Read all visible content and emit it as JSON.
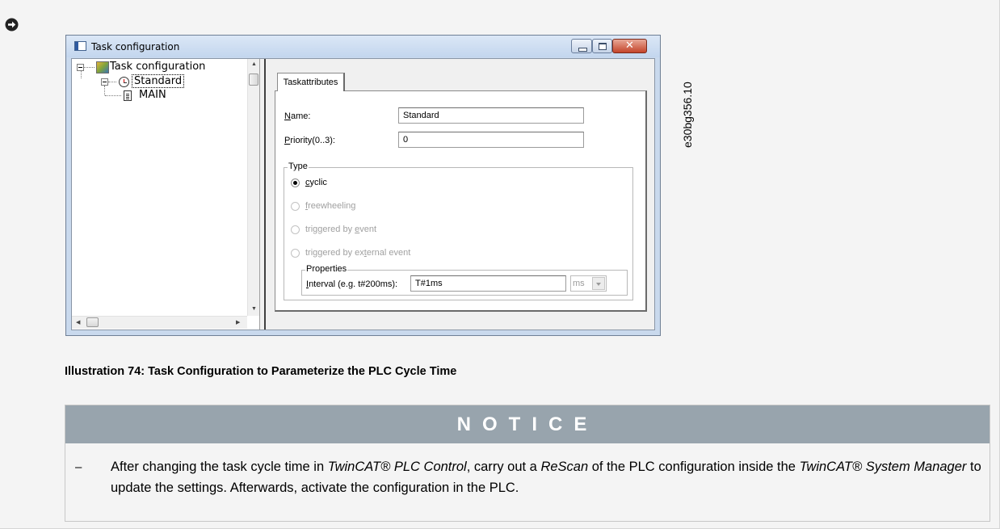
{
  "window": {
    "title": "Task configuration",
    "close_glyph": "✕"
  },
  "tree": {
    "root": "Task configuration",
    "child": "Standard",
    "leaf": "MAIN"
  },
  "tab": {
    "label": "Taskattributes"
  },
  "form": {
    "name_label_u": "N",
    "name_label_rest": "ame:",
    "name_value": "Standard",
    "priority_label_u": "P",
    "priority_label_rest": "riority(0..3):",
    "priority_value": "0",
    "type_group": "Type",
    "radios": [
      {
        "u_pre": "",
        "u": "c",
        "rest": "yclic",
        "checked": true,
        "enabled": true
      },
      {
        "u_pre": "",
        "u": "f",
        "rest": "reewheeling",
        "checked": false,
        "enabled": false
      },
      {
        "u_pre": "triggered by ",
        "u": "e",
        "rest": "vent",
        "checked": false,
        "enabled": false
      },
      {
        "u_pre": "triggered by ex",
        "u": "t",
        "rest": "ernal event",
        "checked": false,
        "enabled": false
      }
    ],
    "properties_group": "Properties",
    "interval_label_u": "I",
    "interval_label_rest": "nterval (e.g. t#200ms):",
    "interval_value": "T#1ms",
    "unit_value": "ms"
  },
  "figure_id": "e30bg356.10",
  "caption": "Illustration 74: Task Configuration to Parameterize the PLC Cycle Time",
  "notice": {
    "heading": "NOTICE",
    "dash": "–",
    "text_1": "After changing the task cycle time in ",
    "text_1_em": "TwinCAT® PLC Control",
    "text_2": ", carry out a ",
    "text_2_em": "ReScan",
    "text_3": " of the PLC configuration in­side the ",
    "text_3_em": "TwinCAT® System Manager",
    "text_4": " to update the settings. Afterwards, activate the configuration in the PLC."
  }
}
